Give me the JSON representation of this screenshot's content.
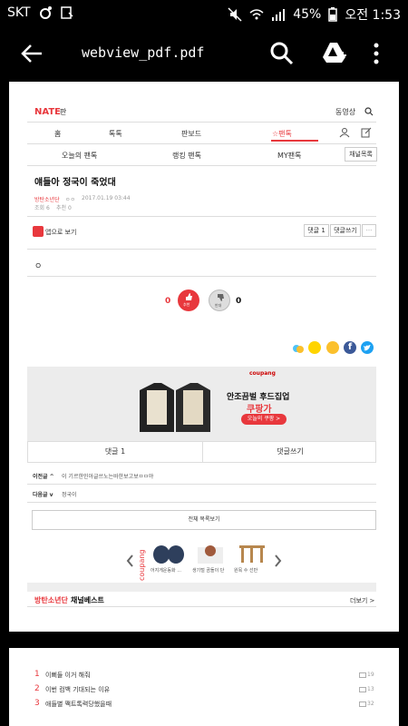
{
  "status": {
    "carrier": "SKT",
    "battery": "45%",
    "time": "오전 1:53"
  },
  "app": {
    "title": "webview_pdf.pdf"
  },
  "nate": {
    "logo": "NATE",
    "logo_sub": "판",
    "video": "동영상",
    "tabs": [
      "홈",
      "톡톡",
      "판보드",
      "☆팬톡"
    ],
    "subtabs": [
      "오늘의 팬톡",
      "랭킹 팬톡",
      "MY팬톡"
    ],
    "channel_list": "채널목록",
    "post_title": "얘들아 정국이 죽었대",
    "author": "방탄소년단",
    "meta1": "ㅇㅇ",
    "date": "2017.01.19 03:44",
    "views": "조회 6",
    "recommend": "추천 0",
    "app_view": "앱으로 보기",
    "comment_count_btn": "댓글 1",
    "write_comment_btn": "댓글쓰기",
    "more_btn": "···",
    "body_text": "ㅇ",
    "like_count": "0",
    "like_label": "추천",
    "dislike_count": "0",
    "dislike_label": "반대"
  },
  "ad": {
    "brand": "coupang",
    "headline": "안조끔벌 후드집업",
    "brand_kr": "쿠팡가",
    "cta": "오늘의 쿠팡 >"
  },
  "comments": {
    "tab1": "댓글 1",
    "tab2": "댓글쓰기",
    "prev_label": "이전글 ^",
    "prev_text": "이 기르한민아글쓰노는바한보고보ㅁㅁ야",
    "next_label": "다음글 v",
    "next_text": "정국이",
    "list_btn": "전체 목록보기"
  },
  "coupang_products": [
    {
      "name": "어지게운동화 ..."
    },
    {
      "name": "생기털 곰돌이 단"
    },
    {
      "name": "원목 수 선반"
    }
  ],
  "channel_best": {
    "channel": "방탄소년단",
    "label": "채널베스트",
    "more": "더보기 >"
  },
  "best_list": [
    {
      "rank": "1",
      "title": "이뻐들 이거 해줘",
      "count": "19"
    },
    {
      "rank": "2",
      "title": "이번 컴백 기대되는 이유",
      "count": "13"
    },
    {
      "rank": "3",
      "title": "애들별 짹트톡력당했을때",
      "count": "32"
    }
  ],
  "colors": {
    "accent": "#e8383d",
    "nate_red": "#e8383d",
    "facebook": "#3b5998",
    "twitter": "#1da1f2",
    "kakao": "#ffd400"
  }
}
